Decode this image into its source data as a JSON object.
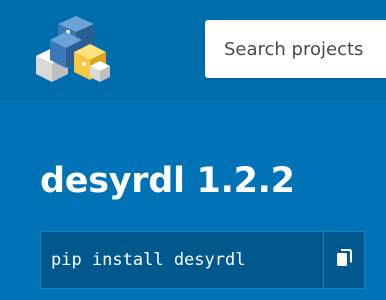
{
  "header": {
    "logo_icon": "python-package-cubes-logo",
    "search": {
      "placeholder": "Search projects",
      "value": ""
    }
  },
  "package": {
    "title": "desyrdl 1.2.2",
    "install_command": "pip install desyrdl",
    "copy_icon": "copy-icon"
  },
  "colors": {
    "header_bg": "#006dad",
    "hero_bg": "#0073b7",
    "pip_box_bg": "#00588c",
    "logo_blue": "#3b78b6",
    "logo_yellow": "#f7c843"
  }
}
